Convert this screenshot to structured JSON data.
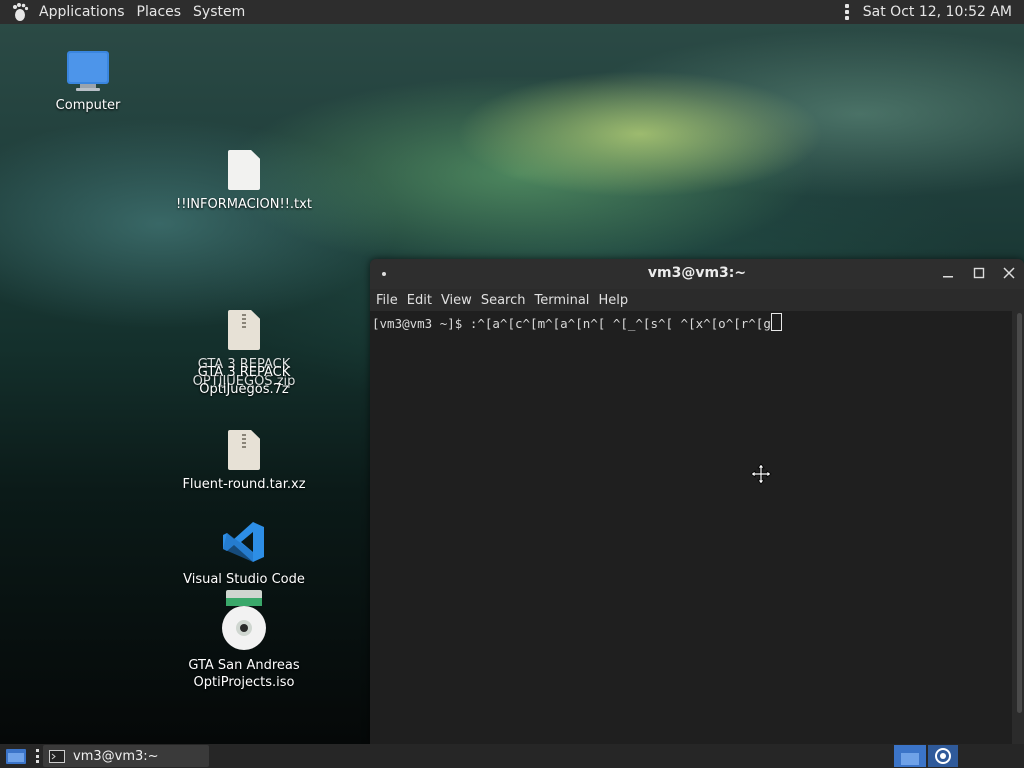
{
  "top_panel": {
    "menu": [
      "Applications",
      "Places",
      "System"
    ],
    "clock": "Sat Oct 12, 10:52 AM"
  },
  "desktop": {
    "icons": [
      {
        "label": "Computer",
        "icon": "computer-icon"
      },
      {
        "label": "!!INFORMACION!!.txt",
        "icon": "text-file-icon"
      },
      {
        "label": "GTA 3 REPACK OPTIJUEGOS.zip",
        "icon": "archive-icon"
      },
      {
        "label": "GTA 3 REPACK OptiJuegos.7z",
        "icon": "archive-icon"
      },
      {
        "label": "Fluent-round.tar.xz",
        "icon": "archive-icon"
      },
      {
        "label": "Visual Studio Code",
        "icon": "vscode-icon"
      },
      {
        "label": "GTA San Andreas OptiProjects.iso",
        "icon": "disc-image-icon"
      }
    ]
  },
  "terminal": {
    "title": "vm3@vm3:~",
    "menu": [
      "File",
      "Edit",
      "View",
      "Search",
      "Terminal",
      "Help"
    ],
    "prompt_line": "[vm3@vm3 ~]$ :^[a^[c^[m^[a^[n^[ ^[_^[s^[ ^[x^[o^[r^[g"
  },
  "taskbar": {
    "task_label": "vm3@vm3:~"
  },
  "colors": {
    "panel": "#2d2d2d",
    "workspace_active": "#3b74c8",
    "terminal_bg": "#1f1f1f"
  }
}
